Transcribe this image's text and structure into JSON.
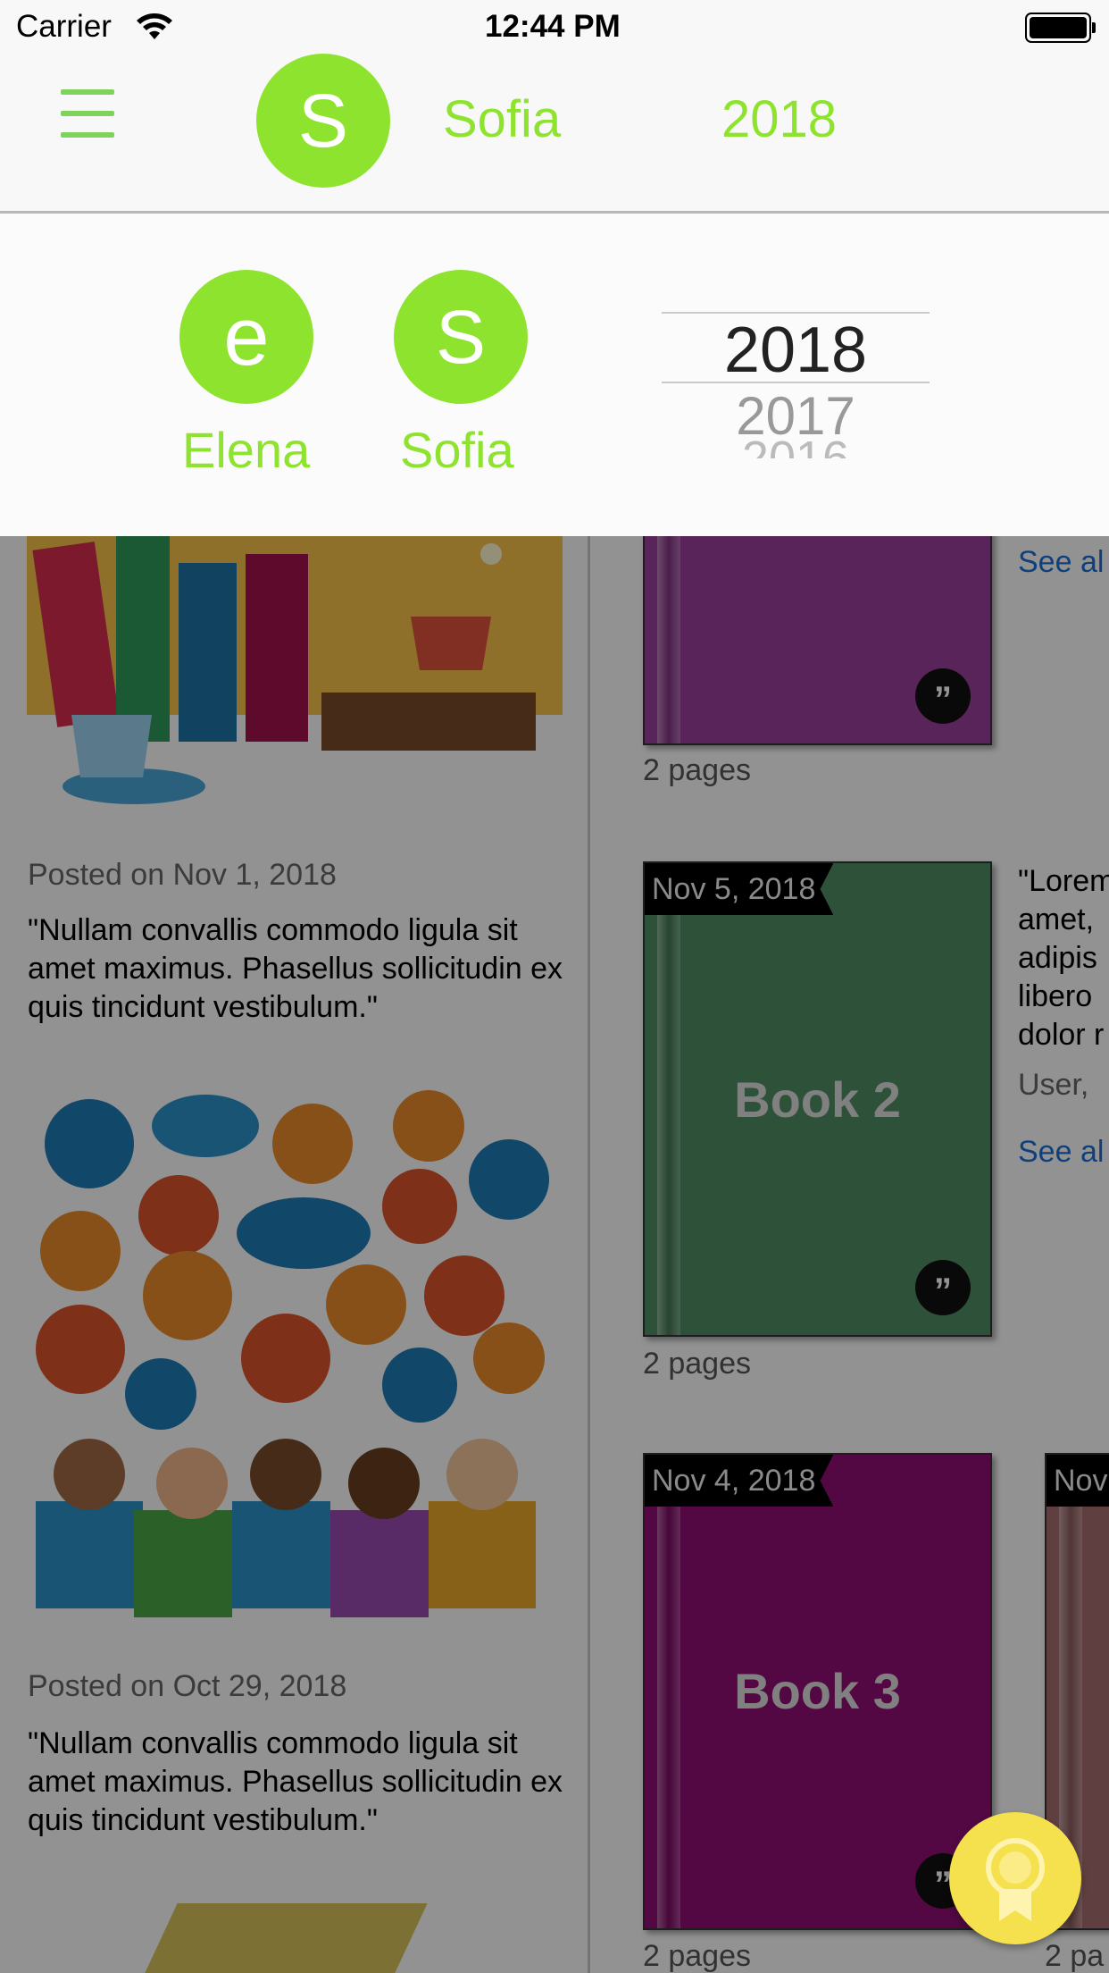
{
  "status_bar": {
    "carrier": "Carrier",
    "time": "12:44 PM"
  },
  "nav": {
    "user_initial": "S",
    "user_name": "Sofia",
    "year": "2018"
  },
  "dropdown": {
    "users": [
      {
        "initial": "e",
        "name": "Elena"
      },
      {
        "initial": "S",
        "name": "Sofia"
      }
    ],
    "years": [
      "2018",
      "2017",
      "2016"
    ]
  },
  "posts": [
    {
      "date": "Posted on Nov 1, 2018",
      "quote": "\"Nullam convallis commodo ligula sit amet maximus. Phasellus sollicitudin ex quis tincidunt vestibulum.\""
    },
    {
      "date": "Posted on Oct 29, 2018",
      "quote": "\"Nullam convallis commodo ligula sit amet maximus. Phasellus sollicitudin ex quis tincidunt vestibulum.\""
    }
  ],
  "books": [
    {
      "pages": "2 pages",
      "color": "#9a3f9a"
    },
    {
      "date": "Nov 5, 2018",
      "title": "Book 2",
      "pages": "2 pages",
      "color": "#4f8c63"
    },
    {
      "date": "Nov 4, 2018",
      "title": "Book 3",
      "pages": "2 pages",
      "color": "#8f0e74"
    },
    {
      "date": "Nov",
      "pages": "2 pa",
      "color": "#a56d70"
    }
  ],
  "side": {
    "see_all_1": "See al",
    "quote_lines": [
      "\"Lorem",
      "amet,",
      "adipis",
      "libero",
      "dolor r"
    ],
    "user": "User,",
    "see_all_2": "See al"
  },
  "colors": {
    "accent": "#8ee32e",
    "fab": "#f5e14d"
  }
}
